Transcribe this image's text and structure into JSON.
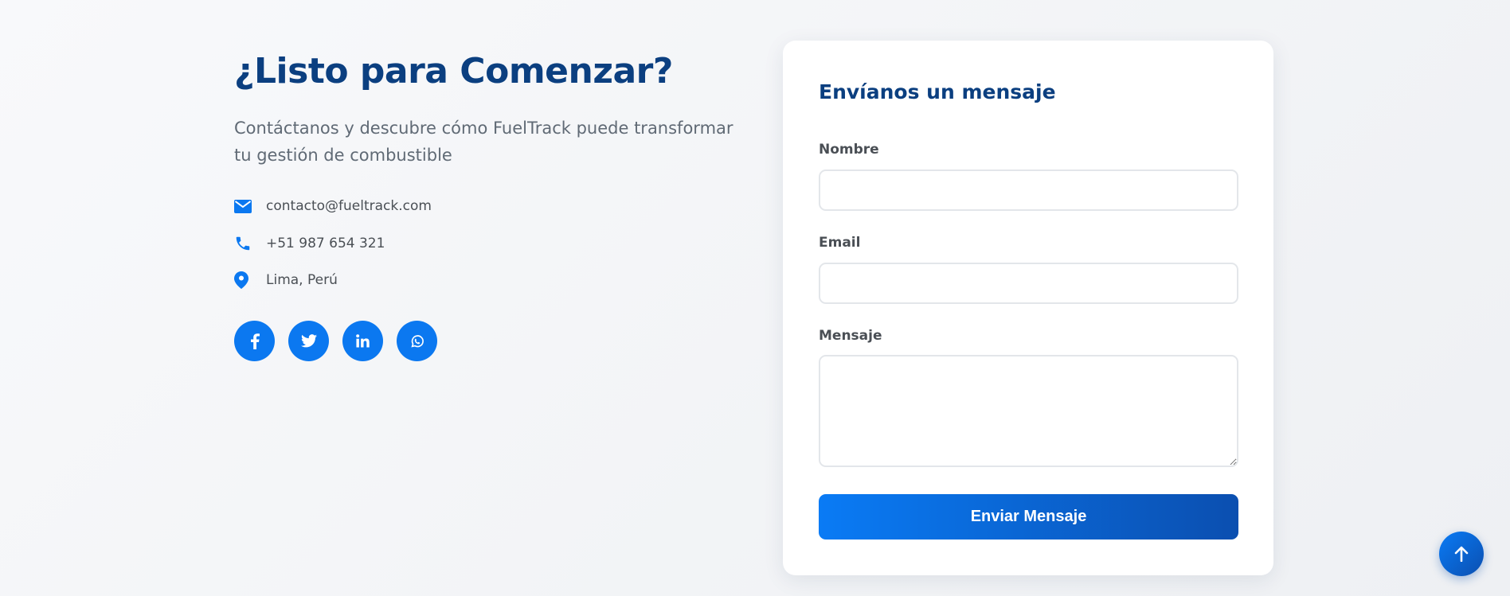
{
  "contact_section": {
    "title": "¿Listo para Comenzar?",
    "subtitle": "Contáctanos y descubre cómo FuelTrack puede transformar tu gestión de combustible",
    "items": [
      {
        "icon": "envelope-icon",
        "text": "contacto@fueltrack.com"
      },
      {
        "icon": "phone-icon",
        "text": "+51 987 654 321"
      },
      {
        "icon": "map-pin-icon",
        "text": "Lima, Perú"
      }
    ],
    "socials": [
      "facebook-icon",
      "twitter-icon",
      "linkedin-icon",
      "whatsapp-icon"
    ]
  },
  "form": {
    "title": "Envíanos un mensaje",
    "name_label": "Nombre",
    "name_value": "",
    "email_label": "Email",
    "email_value": "",
    "message_label": "Mensaje",
    "message_value": "",
    "submit_label": "Enviar Mensaje"
  },
  "colors": {
    "primary": "#0b78f0",
    "heading": "#0b3f80",
    "text": "#606a75"
  }
}
